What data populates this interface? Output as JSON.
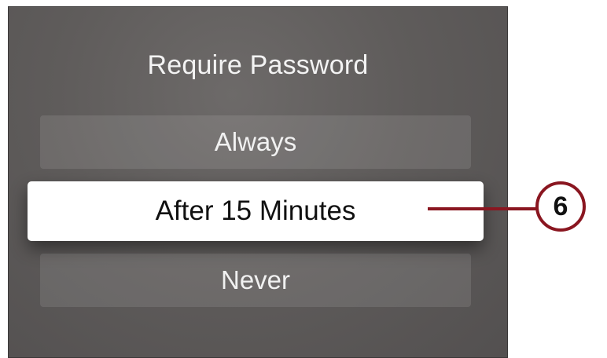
{
  "dialog": {
    "title": "Require Password",
    "options": [
      {
        "label": "Always",
        "selected": false
      },
      {
        "label": "After 15 Minutes",
        "selected": true
      },
      {
        "label": "Never",
        "selected": false
      }
    ]
  },
  "callout": {
    "number": "6",
    "color": "#8a1620"
  }
}
